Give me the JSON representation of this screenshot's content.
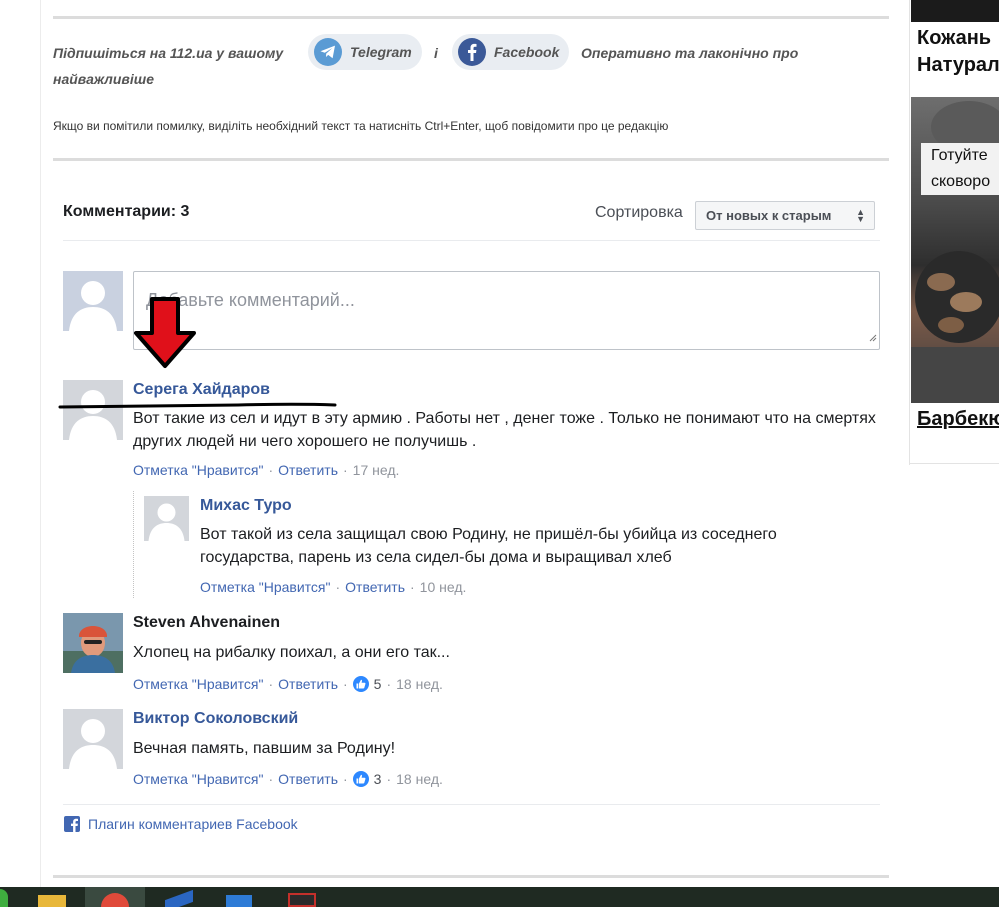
{
  "subscribe": {
    "prefix": "Підпишіться на 112.ua у вашому",
    "telegram_label": "Telegram",
    "and": "і",
    "facebook_label": "Facebook",
    "suffix_line1": "Оперативно та лаконічно про",
    "suffix_line2": "найважливіше"
  },
  "notice": "Якщо ви помітили помилку, виділіть необхідний текст та натисніть Ctrl+Enter, щоб повідомити про це редакцію",
  "comments": {
    "count_label": "Комментарии: 3",
    "sort_label": "Сортировка",
    "sort_value": "От новых к старым",
    "input_placeholder": "Добавьте комментарий...",
    "like_label": "Отметка \"Нравится\"",
    "reply_label": "Ответить",
    "items": [
      {
        "author": "Серега Хайдаров",
        "text": "Вот такие из сел и идут в эту армию . Работы нет , денег тоже . Только не понимают что на смертях других людей ни чего хорошего не получишь .",
        "time": "17 нед."
      },
      {
        "author": "Михас Туро",
        "text": "Вот такой из села защищал свою Родину, не пришёл-бы убийца из соседнего государства, парень из села сидел-бы дома и выращивал хлеб",
        "time": "10 нед."
      },
      {
        "author": "Steven Ahvenainen",
        "text": "Хлопец на рибалку поихал, а они его так...",
        "likes": "5",
        "time": "18 нед."
      },
      {
        "author": "Виктор Соколовский",
        "text": "Вечная память, павшим за Родину!",
        "likes": "3",
        "time": "18 нед."
      }
    ],
    "plugin_label": "Плагин комментариев Facebook"
  },
  "sidebar": {
    "title1_line1": "Кожань",
    "title1_line2": "Натурал",
    "caption_line1": "Готуйте",
    "caption_line2": "сковоро",
    "title2": "Барбекю"
  },
  "colors": {
    "link": "#365899",
    "meta_link": "#4267b2",
    "arrow": "#e0101a",
    "taskbar": "#1f2a22"
  }
}
